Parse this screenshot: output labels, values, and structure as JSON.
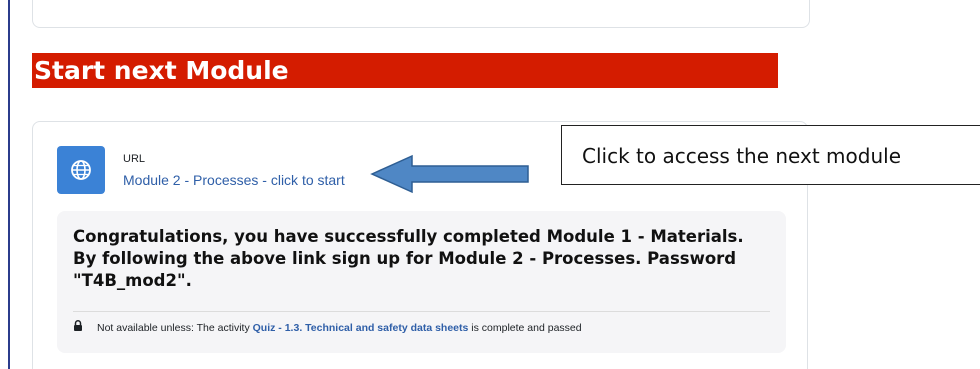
{
  "section": {
    "heading": "Start next Module"
  },
  "activity": {
    "type_label": "URL",
    "link_text": "Module 2 - Processes - click to start",
    "icon": "globe-icon",
    "icon_bg": "#3b82d6",
    "link_color": "#2f5fa8",
    "description": "Congratulations, you have successfully completed Module 1 - Materials. By following the above link sign up for Module 2 - Processes. Password \"T4B_mod2\".",
    "restriction": {
      "icon": "lock-icon",
      "prefix": "Not available unless: The activity",
      "link_text": "Quiz - 1.3. Technical and safety data sheets",
      "suffix": "is complete and passed"
    }
  },
  "annotation": {
    "callout_text": "Click to access the next module",
    "arrow": "left-arrow",
    "arrow_color": "#4f87c5"
  },
  "colors": {
    "heading_bg": "#d41c00",
    "heading_text": "#ffffff"
  }
}
